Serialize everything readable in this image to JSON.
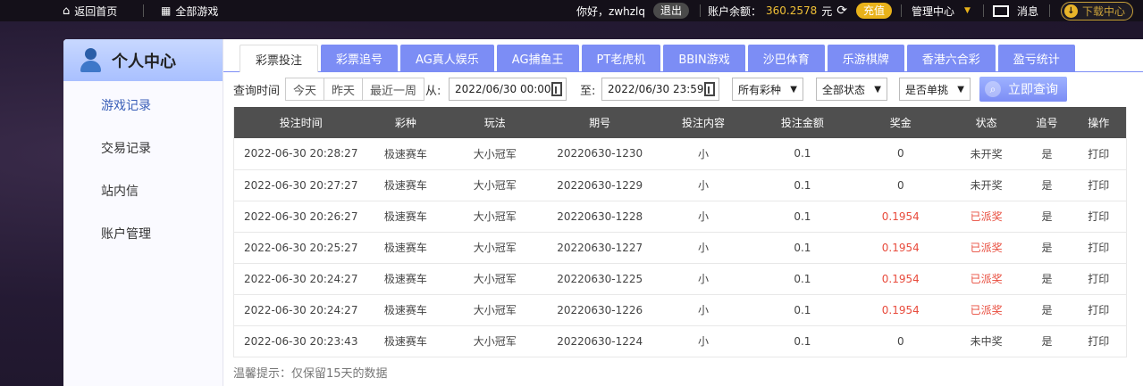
{
  "topbar": {
    "home": "返回首页",
    "all_games": "全部游戏",
    "greeting": "你好，zwhzlq",
    "logout": "退出",
    "balance_label": "账户余额：",
    "balance_value": "360.2578",
    "balance_unit": "元",
    "recharge": "充值",
    "manage": "管理中心",
    "messages": "消息",
    "download": "下载中心"
  },
  "sidebar": {
    "title": "个人中心",
    "items": [
      {
        "label": "游戏记录"
      },
      {
        "label": "交易记录"
      },
      {
        "label": "站内信"
      },
      {
        "label": "账户管理"
      }
    ]
  },
  "tabs": [
    {
      "label": "彩票投注"
    },
    {
      "label": "彩票追号"
    },
    {
      "label": "AG真人娱乐"
    },
    {
      "label": "AG捕鱼王"
    },
    {
      "label": "PT老虎机"
    },
    {
      "label": "BBIN游戏"
    },
    {
      "label": "沙巴体育"
    },
    {
      "label": "乐游棋牌"
    },
    {
      "label": "香港六合彩"
    },
    {
      "label": "盈亏统计"
    }
  ],
  "filters": {
    "label": "查询时间",
    "quick": [
      "今天",
      "昨天",
      "最近一周"
    ],
    "from_label": "从:",
    "from_value": "2022/06/30 00:00",
    "to_label": "至:",
    "to_value": "2022/06/30 23:59",
    "lottery_select": "所有彩种",
    "status_select": "全部状态",
    "single_select": "是否单挑",
    "query_button": "立即查询"
  },
  "table": {
    "headers": [
      "投注时间",
      "彩种",
      "玩法",
      "期号",
      "投注内容",
      "投注金额",
      "奖金",
      "状态",
      "追号",
      "操作"
    ],
    "rows": [
      [
        "2022-06-30 20:28:27",
        "极速赛车",
        "大小冠军",
        "20220630-1230",
        "小",
        "0.1",
        "0",
        "未开奖",
        "是",
        "打印"
      ],
      [
        "2022-06-30 20:27:27",
        "极速赛车",
        "大小冠军",
        "20220630-1229",
        "小",
        "0.1",
        "0",
        "未开奖",
        "是",
        "打印"
      ],
      [
        "2022-06-30 20:26:27",
        "极速赛车",
        "大小冠军",
        "20220630-1228",
        "小",
        "0.1",
        "0.1954",
        "已派奖",
        "是",
        "打印"
      ],
      [
        "2022-06-30 20:25:27",
        "极速赛车",
        "大小冠军",
        "20220630-1227",
        "小",
        "0.1",
        "0.1954",
        "已派奖",
        "是",
        "打印"
      ],
      [
        "2022-06-30 20:24:27",
        "极速赛车",
        "大小冠军",
        "20220630-1225",
        "小",
        "0.1",
        "0.1954",
        "已派奖",
        "是",
        "打印"
      ],
      [
        "2022-06-30 20:24:27",
        "极速赛车",
        "大小冠军",
        "20220630-1226",
        "小",
        "0.1",
        "0.1954",
        "已派奖",
        "是",
        "打印"
      ],
      [
        "2022-06-30 20:23:43",
        "极速赛车",
        "大小冠军",
        "20220630-1224",
        "小",
        "0.1",
        "0",
        "未中奖",
        "是",
        "打印"
      ]
    ]
  },
  "tip": "温馨提示：仅保留15天的数据",
  "colors": {
    "accent": "#7c8df5",
    "win": "#e84c3d",
    "gold": "#e8b21a"
  }
}
